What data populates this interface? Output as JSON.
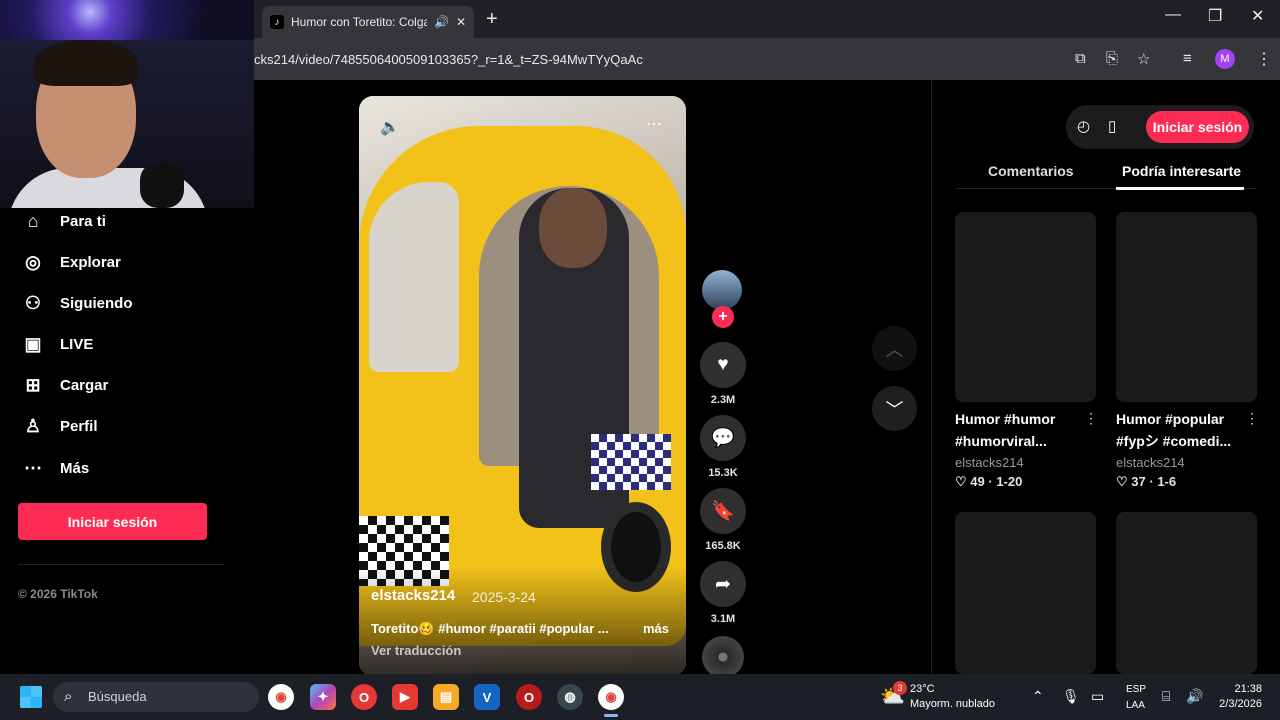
{
  "browser": {
    "tab_title": "Humor con Toretito: Colgar",
    "url": "cks214/video/7485506400509103365?_r=1&_t=ZS-94MwTYyQaAc",
    "profile_initial": "M"
  },
  "sidebar": {
    "items": [
      {
        "label": "Para ti",
        "icon": "home-icon"
      },
      {
        "label": "Explorar",
        "icon": "compass-icon"
      },
      {
        "label": "Siguiendo",
        "icon": "following-icon"
      },
      {
        "label": "LIVE",
        "icon": "live-icon"
      },
      {
        "label": "Cargar",
        "icon": "upload-icon"
      },
      {
        "label": "Perfil",
        "icon": "profile-icon"
      },
      {
        "label": "Más",
        "icon": "more-icon"
      }
    ],
    "login_label": "Iniciar sesión",
    "copyright": "© 2026 TikTok"
  },
  "video": {
    "author": "elstacks214",
    "date": "2025-3-24",
    "description": "Toretito🥴 #humor #paratii #popular ...",
    "more_label": "más",
    "translate_label": "Ver traducción"
  },
  "actions": {
    "likes": "2.3M",
    "comments": "15.3K",
    "saves": "165.8K",
    "shares": "3.1M"
  },
  "right_panel": {
    "login_label": "Iniciar sesión",
    "tabs": [
      "Comentarios",
      "Podría interesarte"
    ],
    "cards": [
      {
        "title_line1": "Humor #humor",
        "title_line2": "#humorviral...",
        "author": "elstacks214",
        "likes": "49",
        "date": "1-20"
      },
      {
        "title_line1": "Humor #popular",
        "title_line2": "#fypシ #comedi...",
        "author": "elstacks214",
        "likes": "37",
        "date": "1-6"
      }
    ]
  },
  "taskbar": {
    "search_placeholder": "Búsqueda",
    "weather_temp": "23°C",
    "weather_desc": "Mayorm. nublado",
    "weather_badge": "3",
    "lang_line1": "ESP",
    "lang_line2": "LAA",
    "time": "21:38",
    "date": "2/3/2026"
  },
  "colors": {
    "accent": "#fe2c55",
    "background": "#000000"
  }
}
